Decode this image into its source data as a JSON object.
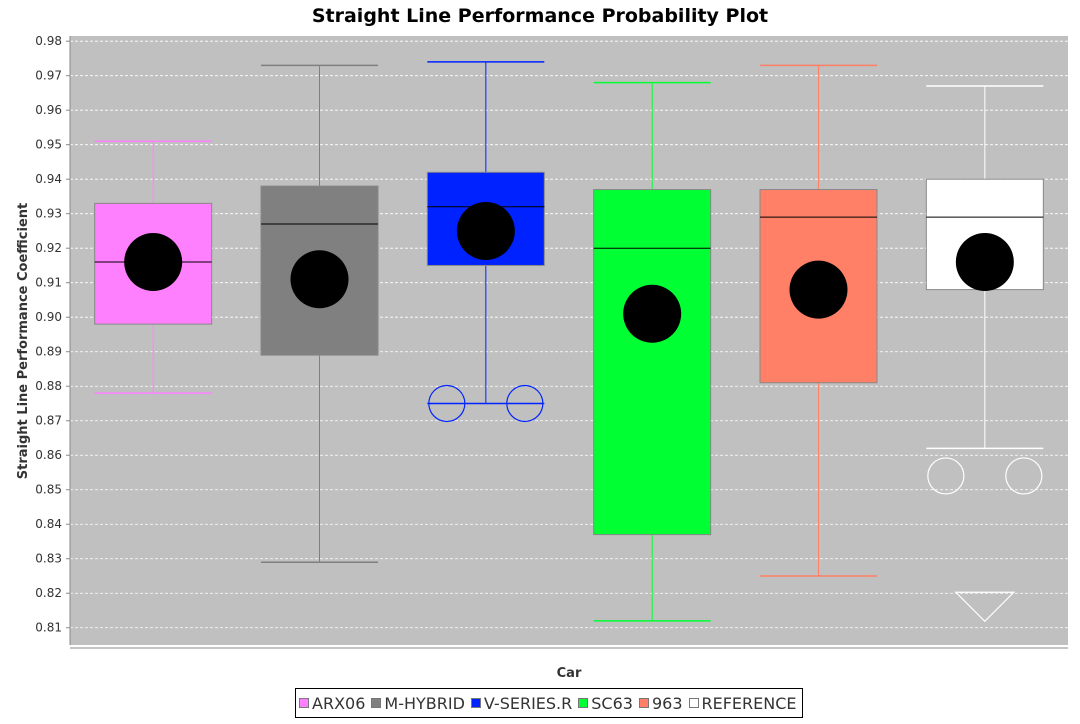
{
  "chart_data": {
    "type": "box",
    "title": "Straight Line Performance Probability Plot",
    "xlabel": "Car",
    "ylabel": "Straight Line Performance Coefficient",
    "ylim": [
      0.805,
      0.9815
    ],
    "yticks": [
      0.81,
      0.82,
      0.83,
      0.84,
      0.85,
      0.86,
      0.87,
      0.88,
      0.89,
      0.9,
      0.91,
      0.92,
      0.93,
      0.94,
      0.95,
      0.96,
      0.97,
      0.98
    ],
    "grid": true,
    "plot_background": "#c0c0c0",
    "legend_position": "bottom",
    "series": [
      {
        "name": "ARX06",
        "color": "#ff80ff",
        "whisker_low": 0.878,
        "q1": 0.898,
        "median": 0.916,
        "q3": 0.933,
        "whisker_high": 0.951,
        "mean": 0.916,
        "outliers": [],
        "far_outliers": []
      },
      {
        "name": "M-HYBRID",
        "color": "#808080",
        "whisker_low": 0.829,
        "q1": 0.889,
        "median": 0.927,
        "q3": 0.938,
        "whisker_high": 0.973,
        "mean": 0.911,
        "outliers": [],
        "far_outliers": []
      },
      {
        "name": "V-SERIES.R",
        "color": "#0022ff",
        "whisker_low": 0.875,
        "q1": 0.915,
        "median": 0.932,
        "q3": 0.942,
        "whisker_high": 0.974,
        "mean": 0.925,
        "outliers": [
          0.875,
          0.875
        ],
        "far_outliers": []
      },
      {
        "name": "SC63",
        "color": "#00ff33",
        "whisker_low": 0.812,
        "q1": 0.837,
        "median": 0.92,
        "q3": 0.937,
        "whisker_high": 0.968,
        "mean": 0.901,
        "outliers": [],
        "far_outliers": []
      },
      {
        "name": "963",
        "color": "#ff8066",
        "whisker_low": 0.825,
        "q1": 0.881,
        "median": 0.929,
        "q3": 0.937,
        "whisker_high": 0.973,
        "mean": 0.908,
        "outliers": [],
        "far_outliers": []
      },
      {
        "name": "REFERENCE",
        "color": "#ffffff",
        "whisker_low": 0.862,
        "q1": 0.908,
        "median": 0.929,
        "q3": 0.94,
        "whisker_high": 0.967,
        "mean": 0.916,
        "outliers": [
          0.854,
          0.854
        ],
        "far_outliers": [
          0.82
        ]
      }
    ]
  }
}
